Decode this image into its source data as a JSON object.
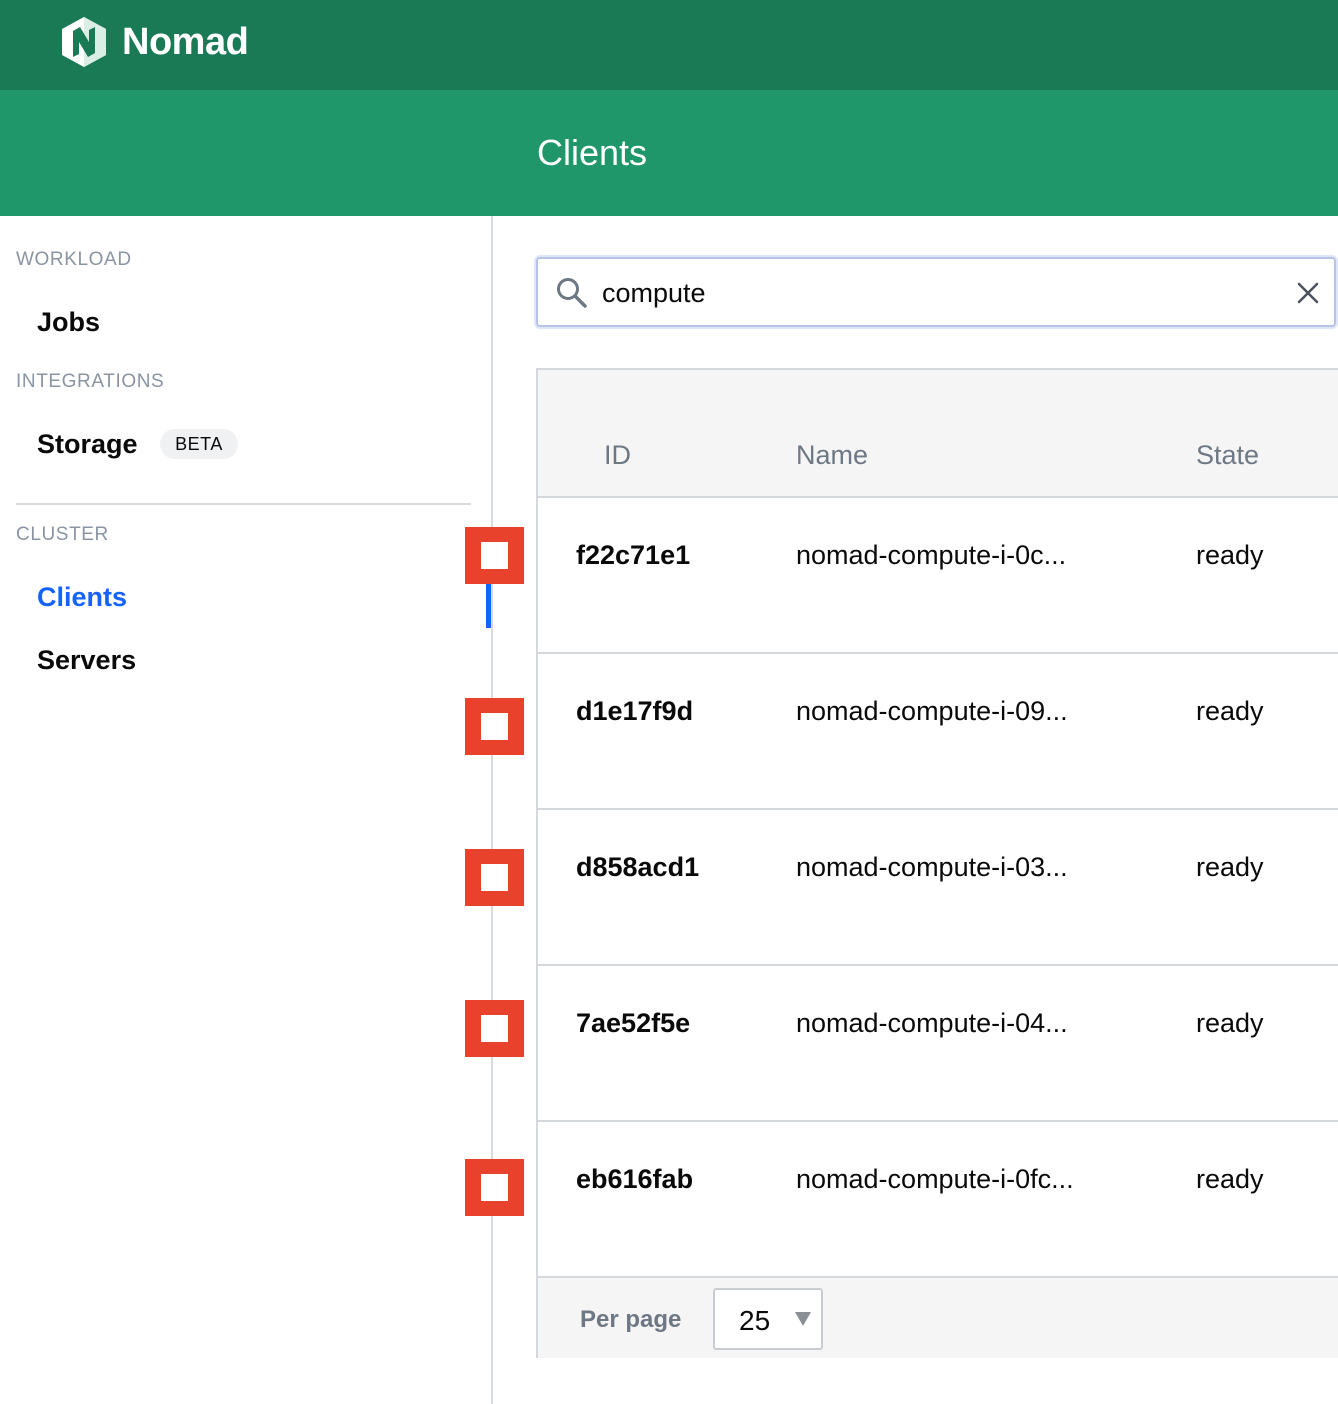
{
  "brand": {
    "name": "Nomad",
    "logo_icon": "nomad-logo-icon"
  },
  "page": {
    "title": "Clients"
  },
  "sidebar": {
    "sections": [
      {
        "label": "WORKLOAD",
        "items": [
          {
            "label": "Jobs",
            "active": false
          }
        ]
      },
      {
        "label": "INTEGRATIONS",
        "items": [
          {
            "label": "Storage",
            "badge": "BETA",
            "active": false
          }
        ]
      },
      {
        "label": "CLUSTER",
        "items": [
          {
            "label": "Clients",
            "active": true
          },
          {
            "label": "Servers",
            "active": false
          }
        ]
      }
    ]
  },
  "search": {
    "value": "compute",
    "icon": "search-icon",
    "clear_icon": "close-icon"
  },
  "table": {
    "columns": [
      "ID",
      "Name",
      "State"
    ],
    "rows": [
      {
        "id": "f22c71e1",
        "name": "nomad-compute-i-0c...",
        "state": "ready"
      },
      {
        "id": "d1e17f9d",
        "name": "nomad-compute-i-09...",
        "state": "ready"
      },
      {
        "id": "d858acd1",
        "name": "nomad-compute-i-03...",
        "state": "ready"
      },
      {
        "id": "7ae52f5e",
        "name": "nomad-compute-i-04...",
        "state": "ready"
      },
      {
        "id": "eb616fab",
        "name": "nomad-compute-i-0fc...",
        "state": "ready"
      }
    ]
  },
  "pagination": {
    "per_page_label": "Per page",
    "per_page_value": "25"
  },
  "colors": {
    "topbar": "#1a7a55",
    "header": "#1f976a",
    "active_link": "#1563ff",
    "marker": "#e8412c"
  }
}
